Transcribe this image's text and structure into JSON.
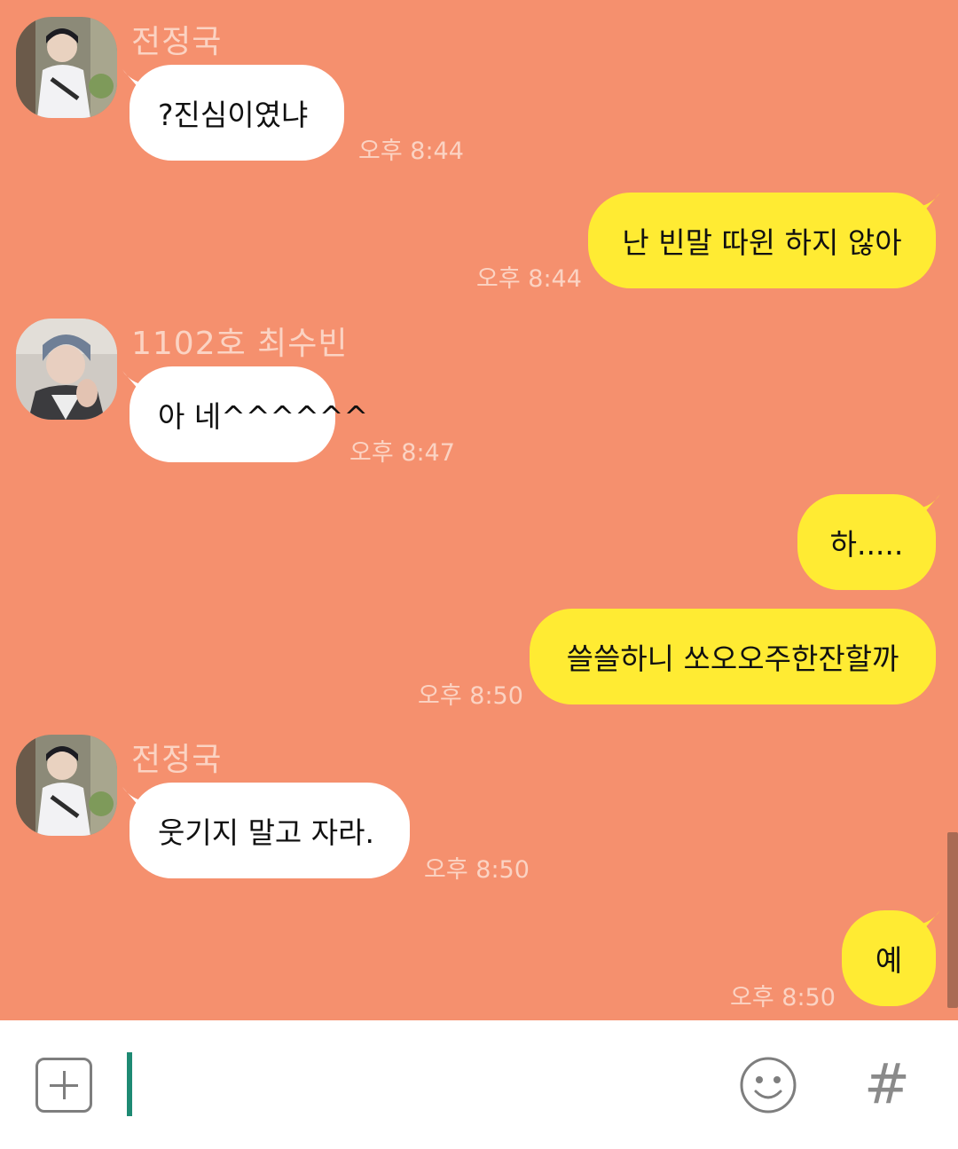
{
  "messages": [
    {
      "side": "in",
      "sender": "전정국",
      "avatar": "avatar-jeongguk",
      "text": "?진심이였냐",
      "time": "오후 8:44"
    },
    {
      "side": "out",
      "text": "난 빈말 따윈 하지 않아",
      "time": "오후 8:44"
    },
    {
      "side": "in",
      "sender": "1102호 최수빈",
      "avatar": "avatar-soobin",
      "text": "아 네^^^^^^",
      "time": "오후 8:47"
    },
    {
      "side": "out",
      "text": "하.....",
      "time": ""
    },
    {
      "side": "out",
      "text": "쓸쓸하니 쏘오오주한잔할까",
      "time": "오후 8:50"
    },
    {
      "side": "in",
      "sender": "전정국",
      "avatar": "avatar-jeongguk",
      "text": "웃기지 말고 자라.",
      "time": "오후 8:50"
    },
    {
      "side": "out",
      "text": "예",
      "time": "오후 8:50"
    }
  ],
  "input": {
    "value": "",
    "placeholder": ""
  },
  "icons": {
    "attach": "plus-square-icon",
    "emoji": "smiley-icon",
    "hashtag": "hashtag-icon"
  },
  "colors": {
    "background": "#F5906E",
    "incoming_bubble": "#FFFFFF",
    "outgoing_bubble": "#FFEB33",
    "meta_text": "#FBD3C3",
    "caret": "#1E8A73"
  }
}
